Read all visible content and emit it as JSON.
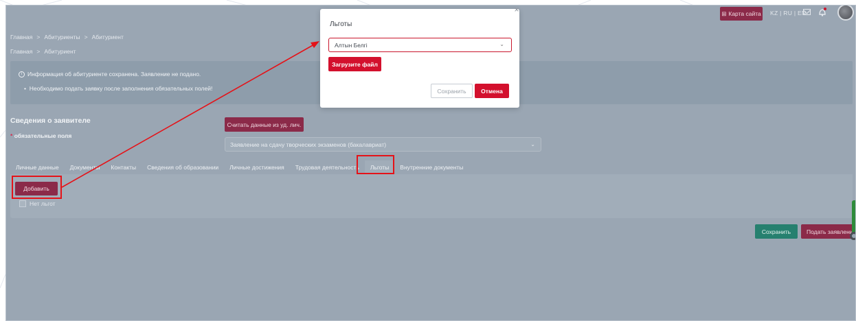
{
  "header": {
    "site_map_label": "Карта сайта",
    "languages": "KZ | RU | EN"
  },
  "breadcrumbs": {
    "primary": [
      "Главная",
      "Абитуриенты",
      "Абитуриент"
    ],
    "secondary": [
      "Главная",
      "Абитуриент"
    ],
    "separator": ">"
  },
  "info": {
    "saved_message": "Информация об абитуриенте сохранена. Заявление не подано.",
    "hint": "Необходимо подать заявку после заполнения обязательных полей!"
  },
  "applicant": {
    "section_title": "Сведения о заявителе",
    "required_label": "обязательные поля",
    "required_mark": "*",
    "read_button": "Считать данные из уд. лич.",
    "application_type": "Заявление на сдачу творческих экзаменов (бакалавриат)"
  },
  "tabs": [
    "Личные данные",
    "Документы",
    "Контакты",
    "Сведения об образовании",
    "Личные достижения",
    "Трудовая деятельность",
    "Льготы",
    "Внутренние документы"
  ],
  "active_tab": "Льготы",
  "benefits": {
    "add_button": "Добавить",
    "no_benefits_label": "Нет льгот",
    "no_benefits_checked": false
  },
  "footer": {
    "save_button": "Сохранить",
    "submit_button": "Подать заявление"
  },
  "modal": {
    "title": "Льготы",
    "close_glyph": "×",
    "selected_benefit": "Алтын Белгі",
    "upload_button": "Загрузите файл",
    "save_button": "Сохранить",
    "cancel_button": "Отмена"
  },
  "colors": {
    "accent": "#d3102d",
    "brand_dark": "#8b2a49",
    "success": "#26806f",
    "annotation": "#e51218"
  },
  "icons": {
    "chevron": "chevron-down-icon",
    "info": "info-icon",
    "mail": "mail-icon",
    "bell": "bell-icon",
    "sitemap": "sitemap-icon"
  }
}
